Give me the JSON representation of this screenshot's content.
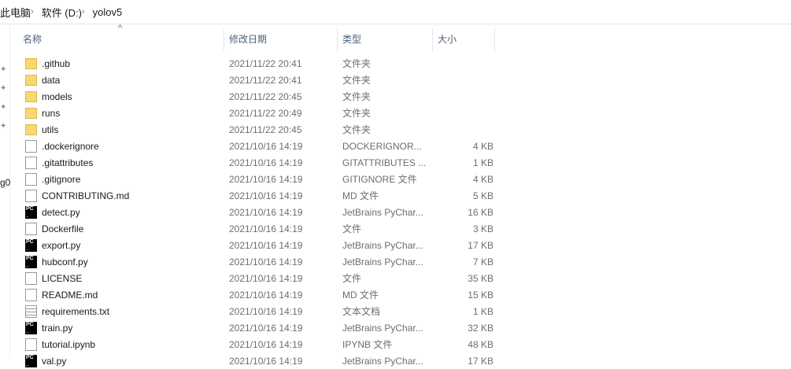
{
  "breadcrumb": [
    "此电脑",
    "软件 (D:)",
    "yolov5"
  ],
  "nav_partial_text": "g0",
  "columns": [
    "名称",
    "修改日期",
    "类型",
    "大小"
  ],
  "files": [
    {
      "name": ".github",
      "date": "2021/11/22 20:41",
      "type": "文件夹",
      "size": "",
      "icon": "folder"
    },
    {
      "name": "data",
      "date": "2021/11/22 20:41",
      "type": "文件夹",
      "size": "",
      "icon": "folder"
    },
    {
      "name": "models",
      "date": "2021/11/22 20:45",
      "type": "文件夹",
      "size": "",
      "icon": "folder"
    },
    {
      "name": "runs",
      "date": "2021/11/22 20:49",
      "type": "文件夹",
      "size": "",
      "icon": "folder"
    },
    {
      "name": "utils",
      "date": "2021/11/22 20:45",
      "type": "文件夹",
      "size": "",
      "icon": "folder"
    },
    {
      "name": ".dockerignore",
      "date": "2021/10/16 14:19",
      "type": "DOCKERIGNOR...",
      "size": "4 KB",
      "icon": "file"
    },
    {
      "name": ".gitattributes",
      "date": "2021/10/16 14:19",
      "type": "GITATTRIBUTES ...",
      "size": "1 KB",
      "icon": "file"
    },
    {
      "name": ".gitignore",
      "date": "2021/10/16 14:19",
      "type": "GITIGNORE 文件",
      "size": "4 KB",
      "icon": "file"
    },
    {
      "name": "CONTRIBUTING.md",
      "date": "2021/10/16 14:19",
      "type": "MD 文件",
      "size": "5 KB",
      "icon": "file"
    },
    {
      "name": "detect.py",
      "date": "2021/10/16 14:19",
      "type": "JetBrains PyChar...",
      "size": "16 KB",
      "icon": "pc"
    },
    {
      "name": "Dockerfile",
      "date": "2021/10/16 14:19",
      "type": "文件",
      "size": "3 KB",
      "icon": "file"
    },
    {
      "name": "export.py",
      "date": "2021/10/16 14:19",
      "type": "JetBrains PyChar...",
      "size": "17 KB",
      "icon": "pc"
    },
    {
      "name": "hubconf.py",
      "date": "2021/10/16 14:19",
      "type": "JetBrains PyChar...",
      "size": "7 KB",
      "icon": "pc"
    },
    {
      "name": "LICENSE",
      "date": "2021/10/16 14:19",
      "type": "文件",
      "size": "35 KB",
      "icon": "file"
    },
    {
      "name": "README.md",
      "date": "2021/10/16 14:19",
      "type": "MD 文件",
      "size": "15 KB",
      "icon": "file"
    },
    {
      "name": "requirements.txt",
      "date": "2021/10/16 14:19",
      "type": "文本文档",
      "size": "1 KB",
      "icon": "txt"
    },
    {
      "name": "train.py",
      "date": "2021/10/16 14:19",
      "type": "JetBrains PyChar...",
      "size": "32 KB",
      "icon": "pc"
    },
    {
      "name": "tutorial.ipynb",
      "date": "2021/10/16 14:19",
      "type": "IPYNB 文件",
      "size": "48 KB",
      "icon": "file"
    },
    {
      "name": "val.py",
      "date": "2021/10/16 14:19",
      "type": "JetBrains PyChar...",
      "size": "17 KB",
      "icon": "pc"
    }
  ]
}
